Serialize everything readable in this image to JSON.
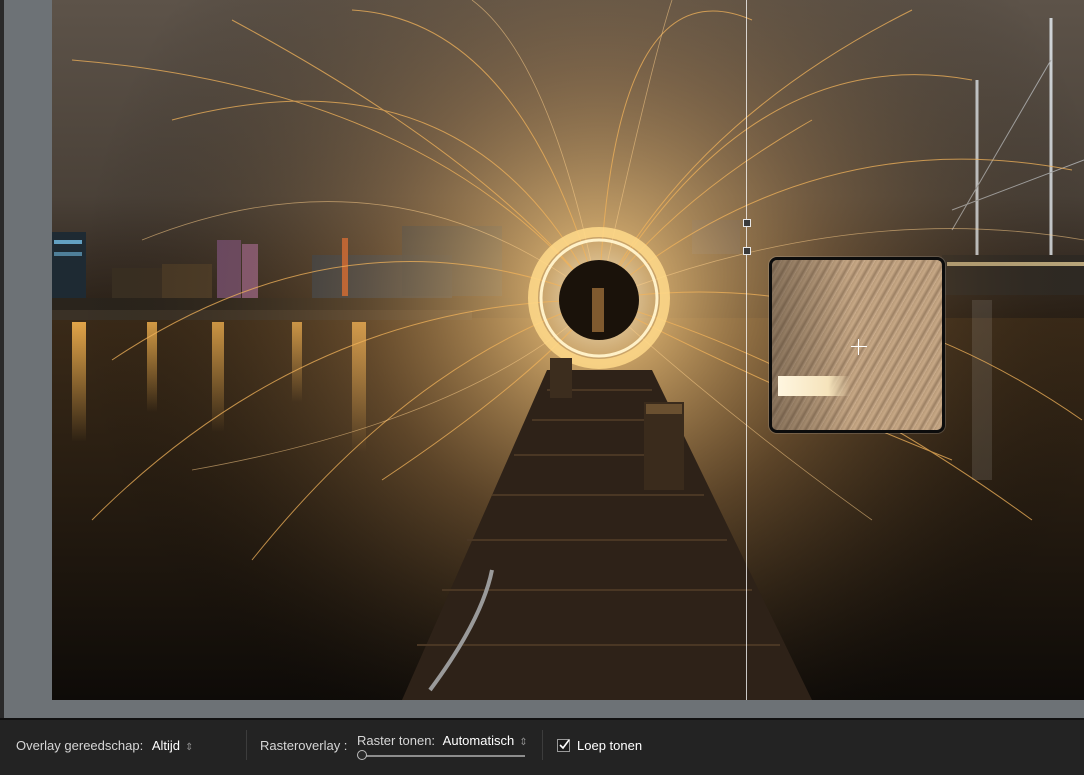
{
  "toolbar": {
    "overlay_tool_label": "Overlay gereedschap:",
    "overlay_tool_value": "Altijd",
    "grid_overlay_label": "Rasteroverlay :",
    "show_grid_label": "Raster tonen:",
    "show_grid_value": "Automatisch",
    "show_loupe_label": "Loep tonen",
    "show_loupe_checked": true
  },
  "icons": {
    "spinner": "up-down-arrows-icon",
    "crosshair": "crosshair-icon",
    "checkmark": "checkmark-icon"
  },
  "colors": {
    "toolbar_bg": "#232323",
    "workspace_bg": "#6d7276",
    "spark": "#f2b35a"
  }
}
